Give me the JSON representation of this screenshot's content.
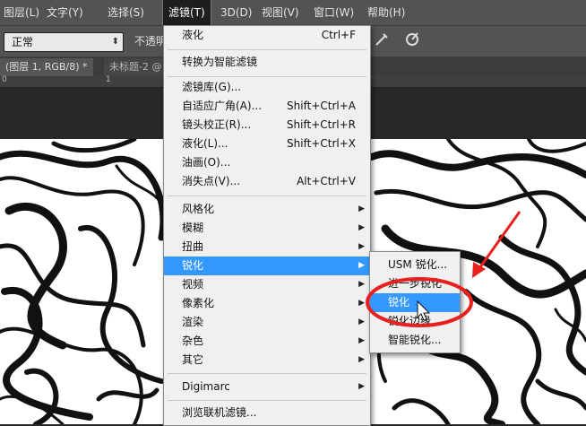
{
  "menubar": {
    "items": [
      "图层(L)",
      "文字(Y)",
      "选择(S)",
      "滤镜(T)",
      "3D(D)",
      "视图(V)",
      "窗口(W)",
      "帮助(H)"
    ]
  },
  "options": {
    "blend_mode": "正常",
    "opacity_label": "不透明"
  },
  "tabs": [
    "(图层 1, RGB/8) *",
    "未标题-2 @"
  ],
  "ruler": {
    "marks": [
      "0",
      "1"
    ]
  },
  "filter_menu": {
    "last_filter": {
      "label": "液化",
      "shortcut": "Ctrl+F"
    },
    "convert_smart": "转换为智能滤镜",
    "group1": [
      {
        "label": "滤镜库(G)...",
        "shortcut": ""
      },
      {
        "label": "自适应广角(A)...",
        "shortcut": "Shift+Ctrl+A"
      },
      {
        "label": "镜头校正(R)...",
        "shortcut": "Shift+Ctrl+R"
      },
      {
        "label": "液化(L)...",
        "shortcut": "Shift+Ctrl+X"
      },
      {
        "label": "油画(O)...",
        "shortcut": ""
      },
      {
        "label": "消失点(V)...",
        "shortcut": "Alt+Ctrl+V"
      }
    ],
    "group2": [
      "风格化",
      "模糊",
      "扭曲",
      "锐化",
      "视频",
      "像素化",
      "渲染",
      "杂色",
      "其它"
    ],
    "digimarc": "Digimarc",
    "browse": "浏览联机滤镜..."
  },
  "sharpen_submenu": {
    "items": [
      "USM 锐化...",
      "进一步锐化",
      "锐化",
      "锐化边缘",
      "智能锐化..."
    ],
    "highlighted_index": 2
  },
  "colors": {
    "highlight": "#3399ff",
    "annotation": "#e8201e"
  }
}
